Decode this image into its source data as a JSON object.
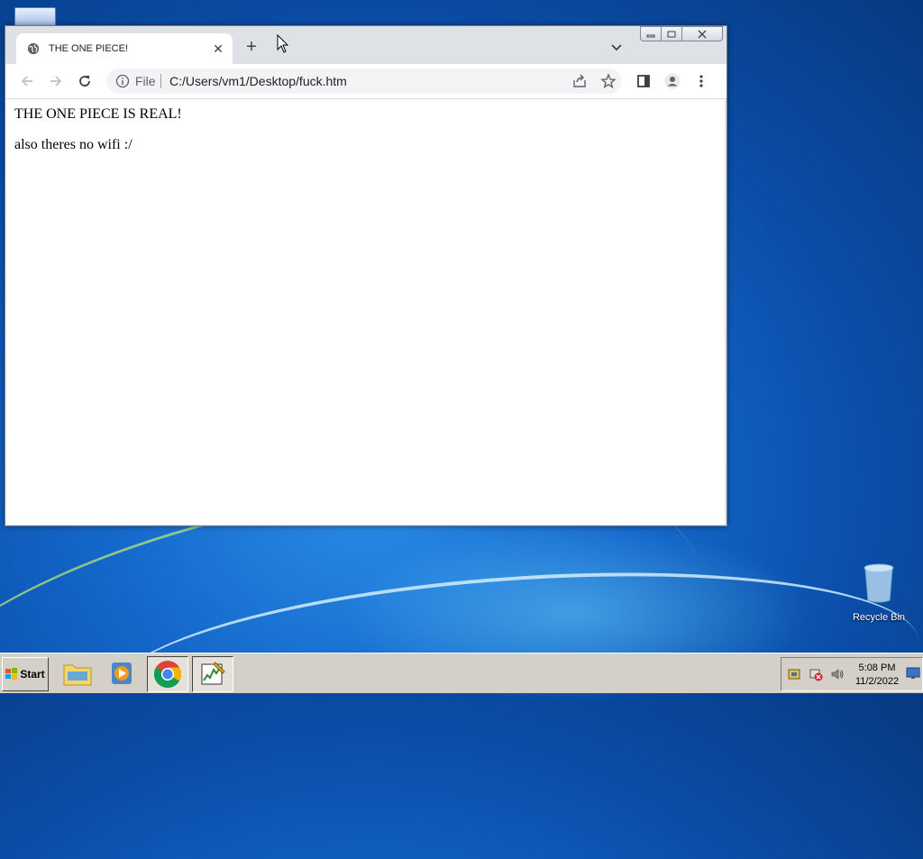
{
  "browser": {
    "tab": {
      "title": "THE ONE PIECE!",
      "close_glyph": "✕"
    },
    "new_tab_glyph": "+",
    "address": {
      "scheme_label": "File",
      "url": "C:/Users/vm1/Desktop/fuck.htm"
    },
    "page": {
      "line1": "THE ONE PIECE IS REAL!",
      "line2": "also theres no wifi :/"
    }
  },
  "desktop": {
    "recycle_bin_label": "Recycle Bin"
  },
  "taskbar": {
    "start_label": "Start",
    "clock_time": "5:08 PM",
    "clock_date": "11/2/2022",
    "apps": [
      "file-explorer-icon",
      "media-player-icon",
      "chrome-icon",
      "task-manager-icon"
    ]
  },
  "colors": {
    "chrome_tabstrip": "#dee1e6",
    "omnibox": "#f1f3f4",
    "taskbar": "#d4d0c8"
  }
}
